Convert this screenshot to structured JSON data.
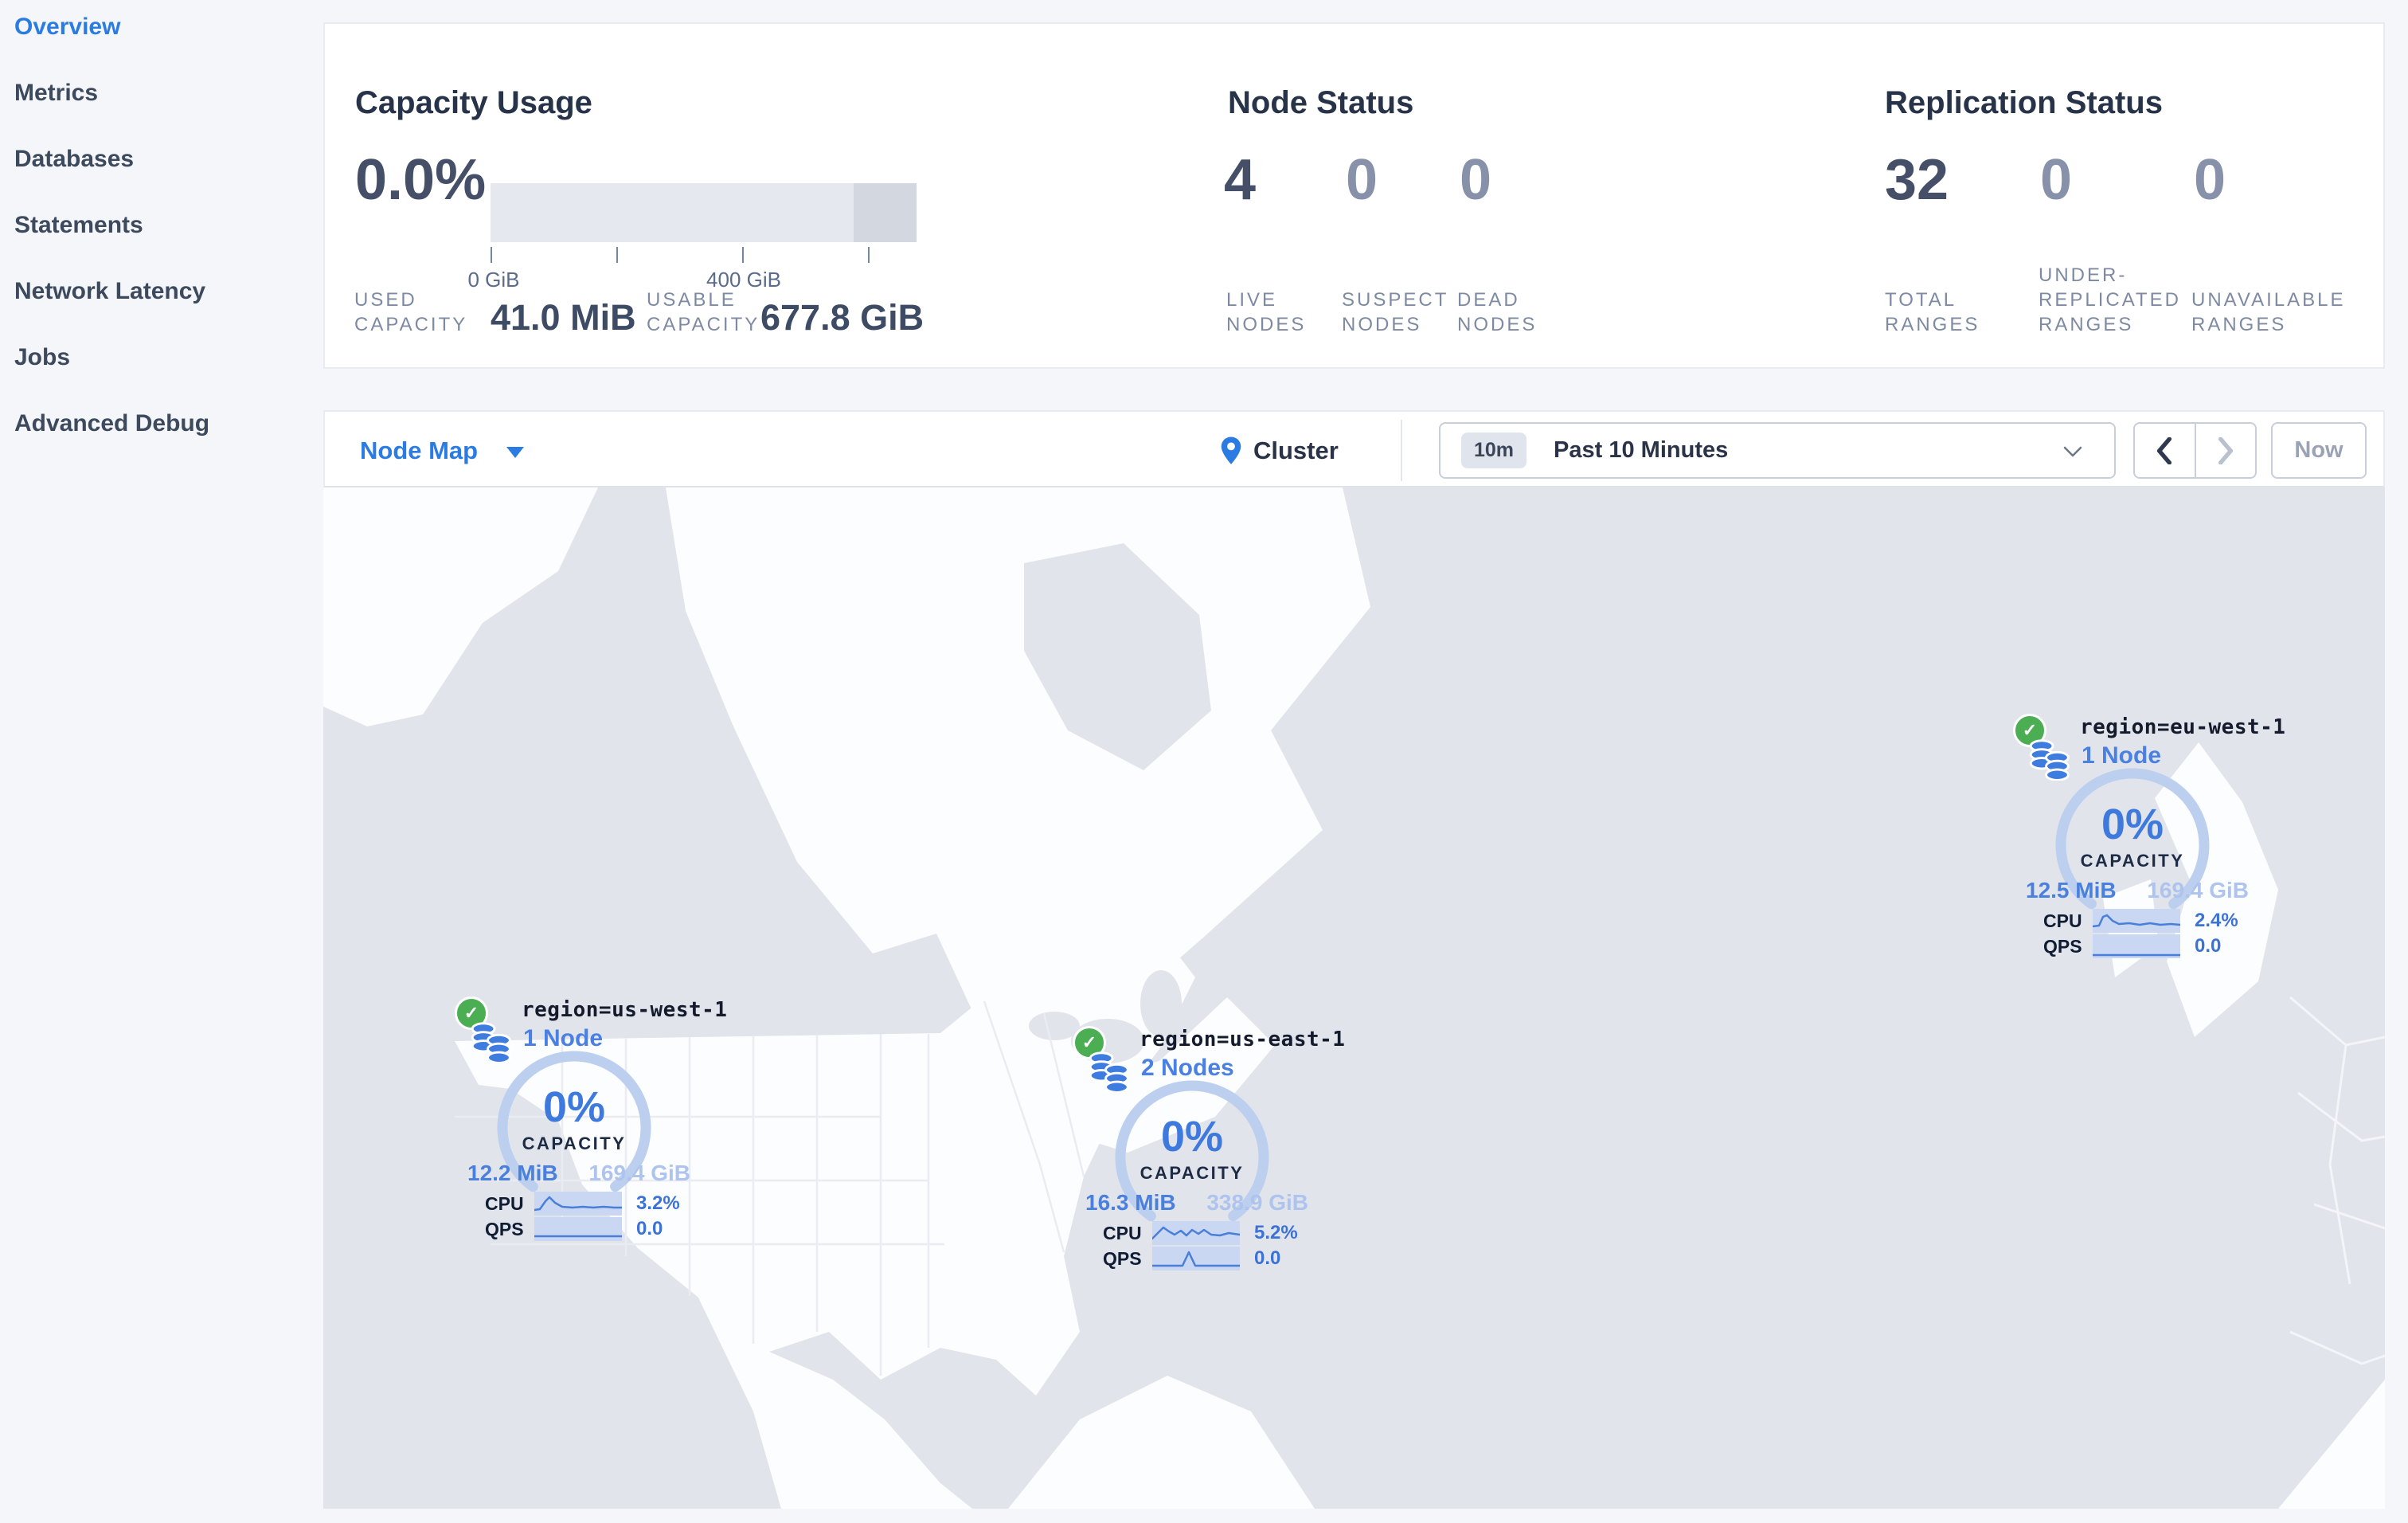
{
  "sidebar": {
    "items": [
      {
        "label": "Overview",
        "active": true
      },
      {
        "label": "Metrics",
        "active": false
      },
      {
        "label": "Databases",
        "active": false
      },
      {
        "label": "Statements",
        "active": false
      },
      {
        "label": "Network Latency",
        "active": false
      },
      {
        "label": "Jobs",
        "active": false
      },
      {
        "label": "Advanced Debug",
        "active": false
      }
    ]
  },
  "summary": {
    "capacity": {
      "title": "Capacity Usage",
      "percent": "0.0%",
      "tick_labels": [
        "0 GiB",
        "400 GiB"
      ],
      "used": {
        "line1": "USED",
        "line2": "CAPACITY",
        "value": "41.0 MiB"
      },
      "usable": {
        "line1": "USABLE",
        "line2": "CAPACITY",
        "value": "677.8 GiB"
      }
    },
    "nodes": {
      "title": "Node Status",
      "stats": [
        {
          "value": "4",
          "lines": [
            "LIVE",
            "NODES"
          ]
        },
        {
          "value": "0",
          "lines": [
            "SUSPECT",
            "NODES"
          ]
        },
        {
          "value": "0",
          "lines": [
            "DEAD",
            "NODES"
          ]
        }
      ]
    },
    "replication": {
      "title": "Replication Status",
      "stats": [
        {
          "value": "32",
          "lines": [
            "TOTAL",
            "RANGES"
          ]
        },
        {
          "value": "0",
          "lines": [
            "UNDER-",
            "REPLICATED",
            "RANGES"
          ]
        },
        {
          "value": "0",
          "lines": [
            "UNAVAILABLE",
            "RANGES"
          ]
        }
      ]
    }
  },
  "toolbar": {
    "view_selector": "Node Map",
    "breadcrumb": "Cluster",
    "time_badge": "10m",
    "time_range": "Past 10 Minutes",
    "now_label": "Now"
  },
  "map": {
    "markers": [
      {
        "id": "us-west",
        "region": "region=us-west-1",
        "nodes": "1 Node",
        "percent": "0%",
        "capacity_label": "CAPACITY",
        "used": "12.2 MiB",
        "usable": "169.4 GiB",
        "cpu_label": "CPU",
        "cpu_value": "3.2%",
        "qps_label": "QPS",
        "qps_value": "0.0",
        "cpu_spark": "0,23 7,22 14,12 19,7 26,14 35,19 48,20 61,19 74,20 87,19 100,20 110,20",
        "qps_spark": "0,24 110,24"
      },
      {
        "id": "us-east",
        "region": "region=us-east-1",
        "nodes": "2 Nodes",
        "percent": "0%",
        "capacity_label": "CAPACITY",
        "used": "16.3 MiB",
        "usable": "338.9 GiB",
        "cpu_label": "CPU",
        "cpu_value": "5.2%",
        "qps_label": "QPS",
        "qps_value": "0.0",
        "cpu_spark": "0,22 7,15 14,8 21,13 28,17 36,12 43,18 50,11 58,16 65,11 74,17 85,18 96,15 110,17",
        "qps_spark": "0,24 38,24 46,7 54,24 110,24"
      },
      {
        "id": "eu-west",
        "region": "region=eu-west-1",
        "nodes": "1 Node",
        "percent": "0%",
        "capacity_label": "CAPACITY",
        "used": "12.5 MiB",
        "usable": "169.4 GiB",
        "cpu_label": "CPU",
        "cpu_value": "2.4%",
        "qps_label": "QPS",
        "qps_value": "0.0",
        "cpu_spark": "0,22 8,21 13,10 18,8 25,15 33,19 46,18 59,20 72,18 85,20 98,19 110,20",
        "qps_spark": "0,26 110,26"
      }
    ]
  },
  "colors": {
    "accent_blue": "#2b7ce2",
    "gauge_blue": "#3e79de",
    "status_green": "#4cae52",
    "text_dark": "#273349",
    "muted_label": "#7e8aa2",
    "map_ocean": "#e1e4eb",
    "map_land": "#fcfdfe"
  }
}
